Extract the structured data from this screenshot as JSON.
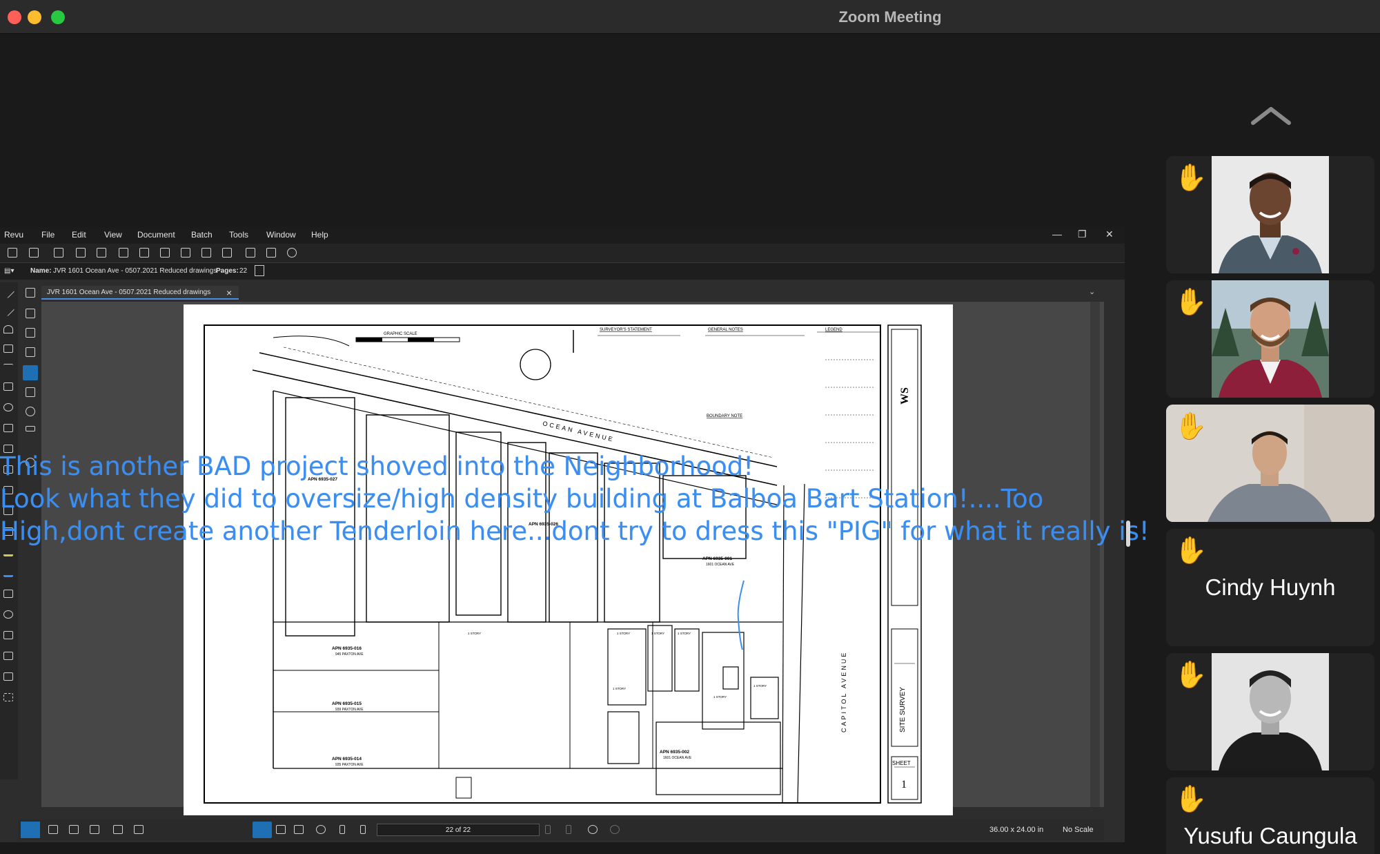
{
  "window": {
    "title": "Zoom Meeting"
  },
  "participants": [
    {
      "name": "",
      "photo": "man-dark-suit-smiling"
    },
    {
      "name": "",
      "photo": "man-burgundy-suit-smiling"
    },
    {
      "name": "",
      "photo": "man-grey-hoodie",
      "active": true
    },
    {
      "name": "Cindy Huynh"
    },
    {
      "name": "",
      "photo": "man-black-white-hoodie"
    },
    {
      "name": "Yusufu Caungula"
    }
  ],
  "revu": {
    "menu": [
      "Revu",
      "File",
      "Edit",
      "View",
      "Document",
      "Batch",
      "Tools",
      "Window",
      "Help"
    ],
    "properties": {
      "name_label": "Name:",
      "name_value": "JVR 1601 Ocean Ave - 0507.2021 Reduced drawings",
      "pages_label": "Pages:",
      "pages_value": "22"
    },
    "tab_label": "JVR 1601 Ocean Ave - 0507.2021 Reduced drawings",
    "status": {
      "page_indicator": "22 of 22",
      "dimensions": "36.00 x 24.00 in",
      "scale": "No Scale"
    }
  },
  "drawing": {
    "graphic_scale": "GRAPHIC SCALE",
    "surveyors_statement": "SURVEYOR'S STATEMENT",
    "general_notes": "GENERAL NOTES",
    "boundary_note": "BOUNDARY NOTE",
    "legend": "LEGEND",
    "ocean_avenue": "OCEAN AVENUE",
    "capitol_avenue": "CAPITOL AVENUE",
    "site_survey": "SITE SURVEY",
    "sheet": "SHEET",
    "sheet_number": "1",
    "firm": "WS",
    "parcels": [
      {
        "apn": "APN 6935-027"
      },
      {
        "apn": "APN 6935-026"
      },
      {
        "apn": "APN 6935-001",
        "sub": "1601 OCEAN AVE"
      },
      {
        "apn": "APN 6935-016",
        "sub": "945 PAXTON AVE"
      },
      {
        "apn": "APN 6935-015",
        "sub": "939 PAXTON AVE"
      },
      {
        "apn": "APN 6935-014",
        "sub": "935 PAXTON AVE"
      },
      {
        "apn": "APN 6935-002",
        "sub": "1601 OCEAN AVE"
      }
    ],
    "story_labels": [
      "1 STORY",
      "1 STORY",
      "1 STORY",
      "1 STORY",
      "1 STORY",
      "1 STORY",
      "1 STORY"
    ]
  },
  "annotation": {
    "line1": "This is another BAD project shoved into the Neighborhood!",
    "line2": "Look what they did to oversize/high density building at Balboa Bart Station!....Too",
    "line3": "High,dont create another Tenderloin here...dont try to dress this \"PIG\" for what it really is!",
    "color": "#3b8ef0"
  }
}
